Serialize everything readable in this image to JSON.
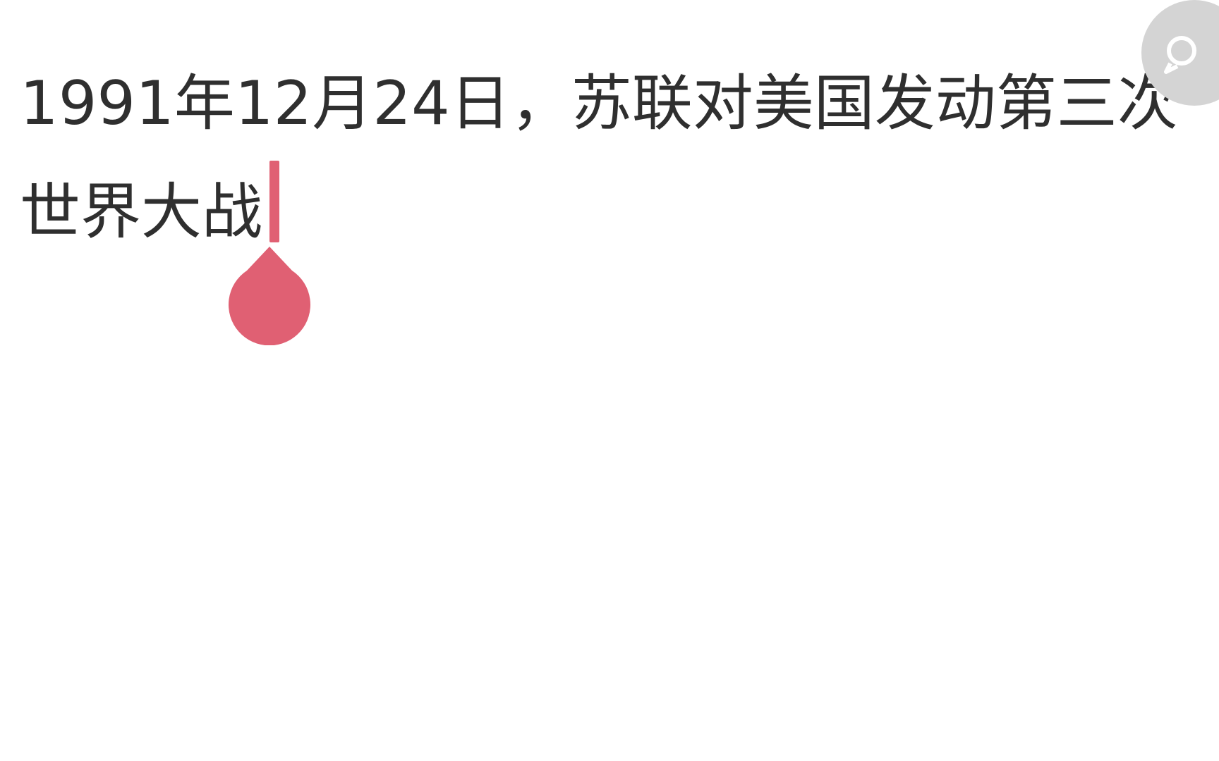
{
  "editor": {
    "lines": [
      "1991年12月24日，苏联对美国发动第三次",
      "世界大战"
    ]
  },
  "colors": {
    "text": "#2f2f2f",
    "accent": "#e06073",
    "background": "#ffffff",
    "floating_button": "#d4d4d4"
  },
  "icons": {
    "floating_button": "assistant-icon",
    "cursor_handle": "cursor-handle-icon"
  }
}
